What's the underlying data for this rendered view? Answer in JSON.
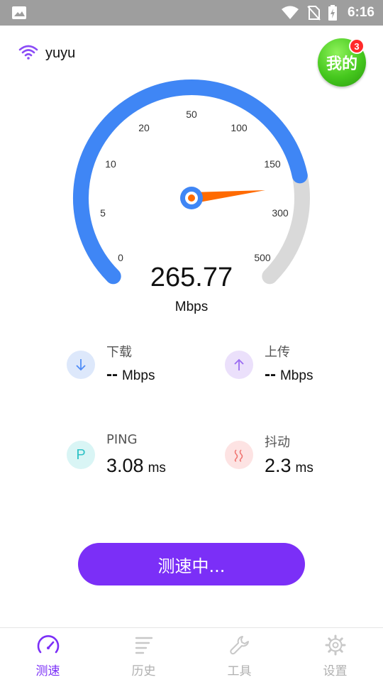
{
  "status_bar": {
    "time": "6:16"
  },
  "network": {
    "ssid": "yuyu"
  },
  "mine": {
    "label": "我的",
    "badge": "3"
  },
  "gauge": {
    "ticks": [
      "0",
      "5",
      "10",
      "20",
      "50",
      "100",
      "150",
      "300",
      "500"
    ],
    "progress_fraction": 0.79,
    "colors": {
      "active": "#3f86f5",
      "track": "#d9d9d9",
      "needle": "#ff6a00"
    }
  },
  "speed": {
    "value": "265.77",
    "unit": "Mbps"
  },
  "metrics": {
    "download": {
      "label": "下载",
      "value": "--",
      "unit": "Mbps"
    },
    "upload": {
      "label": "上传",
      "value": "--",
      "unit": "Mbps"
    },
    "ping": {
      "label": "PING",
      "icon_letter": "P",
      "value": "3.08",
      "unit": "ms"
    },
    "jitter": {
      "label": "抖动",
      "value": "2.3",
      "unit": "ms"
    }
  },
  "action": {
    "label": "测速中..."
  },
  "tabs": [
    {
      "label": "测速",
      "icon": "speedometer-icon",
      "active": true
    },
    {
      "label": "历史",
      "icon": "history-list-icon",
      "active": false
    },
    {
      "label": "工具",
      "icon": "wrench-icon",
      "active": false
    },
    {
      "label": "设置",
      "icon": "gear-icon",
      "active": false
    }
  ],
  "colors": {
    "accent": "#7b2ff7",
    "status_bar": "#9e9e9e"
  }
}
